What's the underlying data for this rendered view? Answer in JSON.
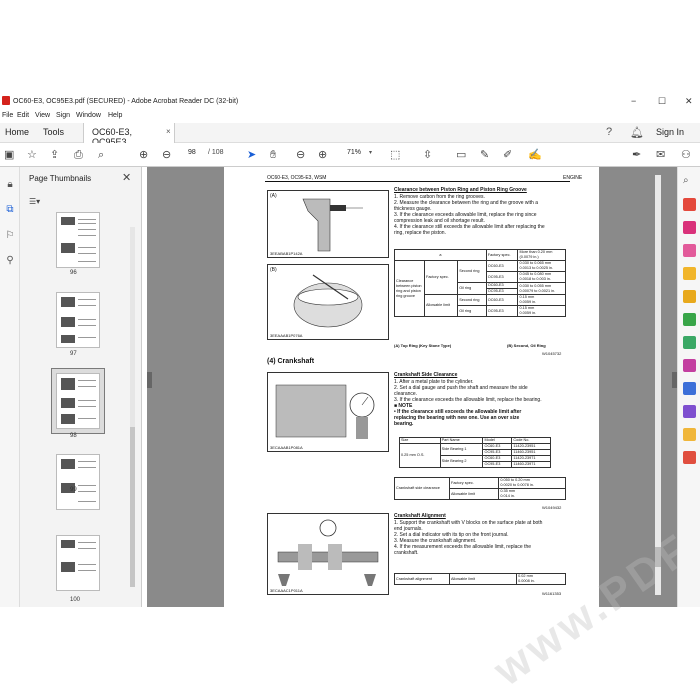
{
  "window": {
    "title": "OC60-E3, OC95E3.pdf (SECURED) - Adobe Acrobat Reader DC (32-bit)",
    "minimize": "−",
    "maximize": "☐",
    "close": "✕"
  },
  "menu": [
    "File",
    "Edit",
    "View",
    "Sign",
    "Window",
    "Help"
  ],
  "tabs": {
    "home": "Home",
    "tools": "Tools",
    "doc": "OC60-E3, OC95E3...",
    "signin": "Sign In"
  },
  "toolbar": {
    "page_current": "98",
    "page_total": "/ 108",
    "zoom": "71%"
  },
  "thumbnails": {
    "title": "Page Thumbnails",
    "pages": [
      "96",
      "97",
      "98",
      "99",
      "100"
    ]
  },
  "page": {
    "header_left": "OC60-E3, OC95-E3, WSM",
    "header_right": "ENGINE",
    "fig_a_label": "(A)",
    "fig_a_caption": "3EEABAB1P142A",
    "fig_b_label": "(B)",
    "fig_b_caption": "3EEAAAB1P076A",
    "s1_title": "Clearance between Piston Ring and Piston Ring Groove",
    "s1_steps": [
      "1.  Remove carbon from the ring grooves.",
      "2.  Measure the clearance between the ring and the groove with a",
      "     thickness gauge.",
      "3.  If the clearance exceeds allowable limit, replace the ring since",
      "     compression leak and oil shortage result.",
      "4.  If the clearance still exceeds the allowable limit after replacing the",
      "     ring, replace the piston."
    ],
    "t1": {
      "a": "a",
      "fs": "Factory spec.",
      "more": "More than 0.20 mm",
      "more2": "(0.0079 in.)",
      "cl": "Clearance between piston ring and piston ring groove",
      "fs2": "Factory spec.",
      "sr": "Second ring",
      "or": "Oil ring",
      "al": "Allowable limit",
      "m1": "OC60-E3",
      "m2": "OC95-E3",
      "v1": "0.030 to 0.065 mm",
      "v1b": "0.0013 to 0.0025 in.",
      "v2": "0.045 to 0.080 mm",
      "v2b": "0.0018 to 0.003 in.",
      "v3": "0.030 to 0.055 mm",
      "v3b": "0.00079 to 0.0021 in.",
      "v4": "0.15 mm",
      "v4b": "0.0059 in.",
      "v5": "0.15 mm",
      "v5b": "0.0059 in."
    },
    "t1_note_a": "(A) Top Ring (Key Stone Type)",
    "t1_note_b": "(B) Second, Oil Ring",
    "code1": "W1045732",
    "s2_heading": "(4)   Crankshaft",
    "fig_c_caption": "3ECAAAB1P081A",
    "s2_title": "Crankshaft Side Clearance",
    "s2_steps": [
      "1.  After a metal plate to the cylinder.",
      "2.  Set a dial gauge and push the shaft and measure the side",
      "     clearance.",
      "3.  If the clearance exceeds the allowable limit, replace the bearing."
    ],
    "note_title": "■  NOTE",
    "note_lines": [
      "•  If the clearance still exceeds the allowable limit after",
      "   replacing the bearing with new one.  Use an over size",
      "   bearing."
    ],
    "t2": {
      "size": "Size",
      "part": "Part Name",
      "model": "Model",
      "code": "Code No.",
      "sz": "0.25 mm O.S.",
      "sb1": "Side Bearing 1",
      "sb2": "Side Bearing 2",
      "m1": "OC60-E3",
      "m2": "OC95-E3",
      "c1": "11420-23951",
      "c2": "11460-23951",
      "c3": "11420-23971",
      "c4": "11460-23971"
    },
    "t3": {
      "l": "Crankshaft side clearance",
      "fs": "Factory spec.",
      "al": "Allowable limit",
      "v1": "0.050 to 0.20 mm",
      "v1b": "0.0020 to 0.0078 in.",
      "v2": "0.35 mm",
      "v2b": "0.014 in."
    },
    "code2": "W1049432",
    "fig_d_caption": "3ECAAAC1P011A",
    "s3_title": "Crankshaft Alignment",
    "s3_steps": [
      "1.  Support the crankshaft with V blocks on the surface plate at both",
      "     end journals.",
      "2.  Set a dial indicator with its tip on the front journal.",
      "3.  Measure the crankshaft alignment.",
      "4.  If the measurement exceeds the allowable limit, replace the",
      "     crankshaft."
    ],
    "t4": {
      "l": "Crankshaft alignment",
      "al": "Allowable limit",
      "v": "0.02 mm",
      "vb": "0.0008 in."
    },
    "code3": "W1161353"
  }
}
